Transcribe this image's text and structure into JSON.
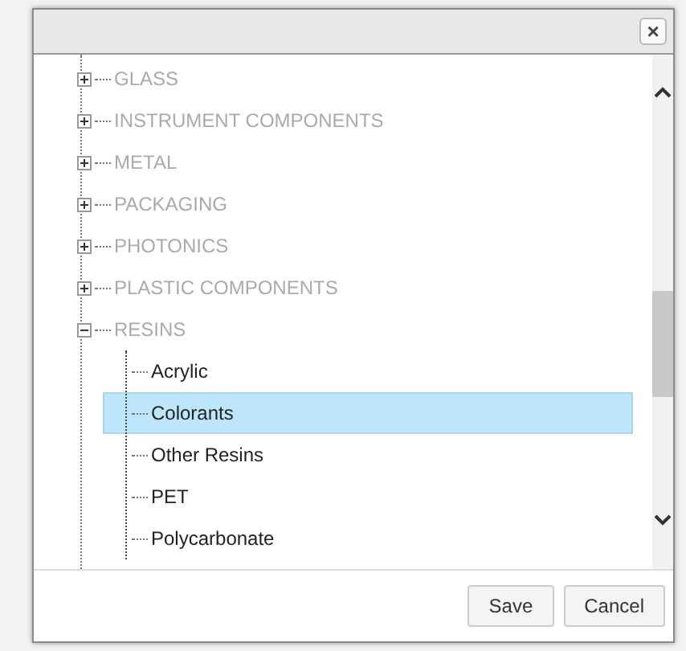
{
  "dialog": {
    "close_label": "×"
  },
  "tree": {
    "items": [
      {
        "label": "GLASS",
        "expanded": false,
        "disabled": true,
        "selected": false
      },
      {
        "label": "INSTRUMENT COMPONENTS",
        "expanded": false,
        "disabled": true,
        "selected": false
      },
      {
        "label": "METAL",
        "expanded": false,
        "disabled": true,
        "selected": false
      },
      {
        "label": "PACKAGING",
        "expanded": false,
        "disabled": true,
        "selected": false
      },
      {
        "label": "PHOTONICS",
        "expanded": false,
        "disabled": true,
        "selected": false
      },
      {
        "label": "PLASTIC COMPONENTS",
        "expanded": false,
        "disabled": true,
        "selected": false
      },
      {
        "label": "RESINS",
        "expanded": true,
        "disabled": true,
        "selected": false,
        "children": [
          {
            "label": "Acrylic",
            "disabled": false,
            "selected": false
          },
          {
            "label": "Colorants",
            "disabled": false,
            "selected": true
          },
          {
            "label": "Other Resins",
            "disabled": false,
            "selected": false
          },
          {
            "label": "PET",
            "disabled": false,
            "selected": false
          },
          {
            "label": "Polycarbonate",
            "disabled": false,
            "selected": false
          }
        ]
      }
    ]
  },
  "buttons": [
    "Save",
    "Cancel"
  ]
}
